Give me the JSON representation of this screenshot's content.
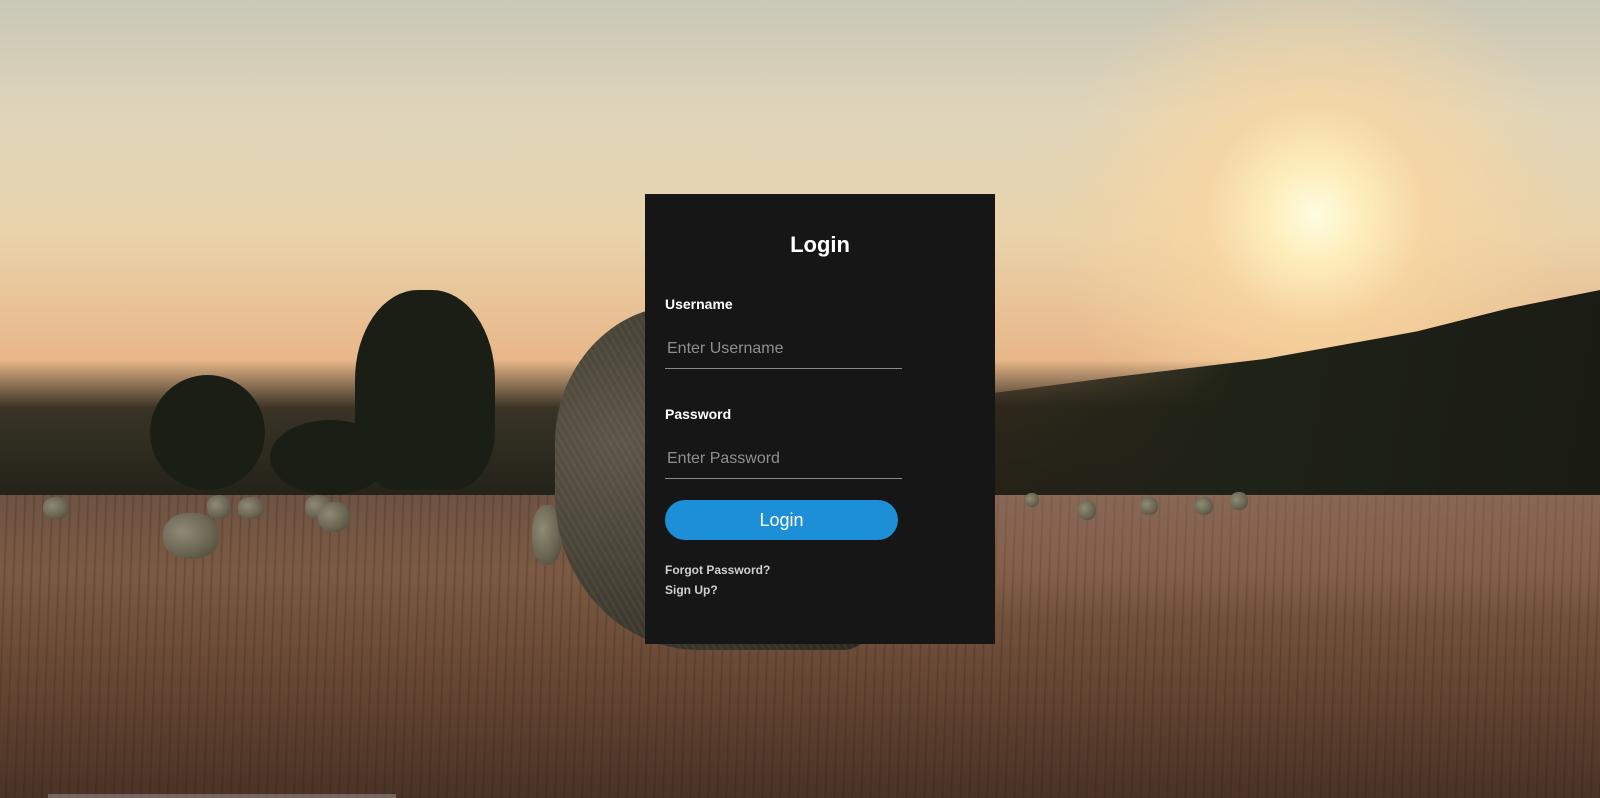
{
  "login": {
    "title": "Login",
    "username_label": "Username",
    "username_placeholder": "Enter Username",
    "password_label": "Password",
    "password_placeholder": "Enter Password",
    "submit_label": "Login",
    "forgot_link": "Forgot Password?",
    "signup_link": "Sign Up?"
  },
  "colors": {
    "card_background": "#161616",
    "button_background": "#1c8fd6",
    "text_primary": "#ffffff",
    "link_text": "#d0d0d0"
  }
}
